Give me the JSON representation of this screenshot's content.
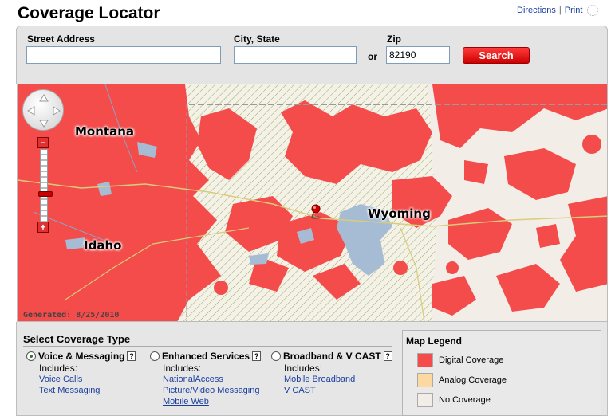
{
  "header": {
    "title": "Coverage Locator",
    "links": [
      "Directions",
      "Print"
    ]
  },
  "search": {
    "street_label": "Street Address",
    "street_value": "",
    "city_label": "City, State",
    "city_value": "",
    "or_text": "or",
    "zip_label": "Zip",
    "zip_value": "82190",
    "button_label": "Search"
  },
  "map": {
    "labels": [
      "Montana",
      "Idaho",
      "Wyoming"
    ],
    "generated": "Generated: 8/25/2010",
    "colors": {
      "digital": "#f44b4b",
      "analog": "#fdd8a0",
      "none": "#f3ede8",
      "water": "#a6bcd4"
    }
  },
  "coverage": {
    "title": "Select Coverage Type",
    "types": [
      {
        "name": "Voice & Messaging",
        "help": "?",
        "includes": "Includes:",
        "links": [
          "Voice Calls",
          "Text Messaging"
        ],
        "selected": true
      },
      {
        "name": "Enhanced Services",
        "help": "?",
        "includes": "Includes:",
        "links": [
          "NationalAccess",
          "Picture/Video Messaging",
          "Mobile Web"
        ],
        "selected": false
      },
      {
        "name": "Broadband & V CAST",
        "help": "?",
        "includes": "Includes:",
        "links": [
          "Mobile Broadband",
          "V CAST"
        ],
        "selected": false
      }
    ]
  },
  "legend": {
    "title": "Map Legend",
    "items": [
      {
        "label": "Digital Coverage",
        "color": "#f44b4b"
      },
      {
        "label": "Analog Coverage",
        "color": "#fdd8a0"
      },
      {
        "label": "No Coverage",
        "color": "#f3ede8"
      }
    ]
  }
}
